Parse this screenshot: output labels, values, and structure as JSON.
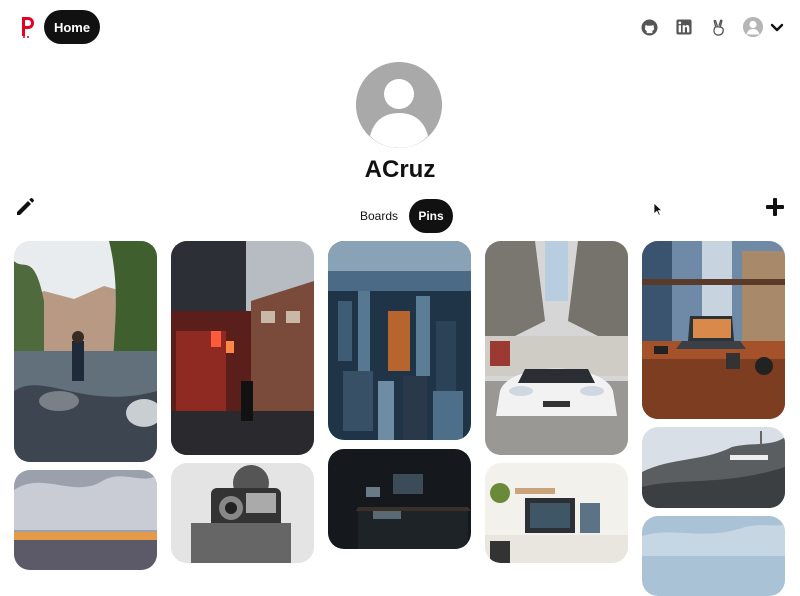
{
  "header": {
    "home_label": "Home",
    "icons": [
      "logo-icon",
      "github-icon",
      "linkedin-icon",
      "angellist-icon",
      "user-avatar-icon",
      "chevron-down-icon"
    ]
  },
  "profile": {
    "username": "ACruz"
  },
  "tabs": [
    {
      "label": "Boards",
      "active": false
    },
    {
      "label": "Pins",
      "active": true
    }
  ],
  "actions": {
    "edit_icon": "pencil-icon",
    "add_icon": "plus-icon"
  },
  "pins": [
    {
      "id": "pin-river-hiker",
      "subject": "hiker on river rocks"
    },
    {
      "id": "pin-neon-alley",
      "subject": "city alley with red lights"
    },
    {
      "id": "pin-city-skyline",
      "subject": "aerial city skyline"
    },
    {
      "id": "pin-white-car",
      "subject": "white sports car under bridge"
    },
    {
      "id": "pin-laptop-desk",
      "subject": "laptop on desk with city view"
    },
    {
      "id": "pin-sunset-clouds",
      "subject": "clouds at sunset"
    },
    {
      "id": "pin-camera-person",
      "subject": "person holding vintage camera"
    },
    {
      "id": "pin-dark-desk",
      "subject": "dark desk with monitor"
    },
    {
      "id": "pin-workspace",
      "subject": "workspace with monitor and plants"
    },
    {
      "id": "pin-hollywood-sign",
      "subject": "hillside with sign"
    },
    {
      "id": "pin-sky",
      "subject": "blue sky"
    }
  ],
  "colors": {
    "accent": "#e60023",
    "active_tab_bg": "#111111",
    "avatar_gray": "#a9a9a9"
  }
}
